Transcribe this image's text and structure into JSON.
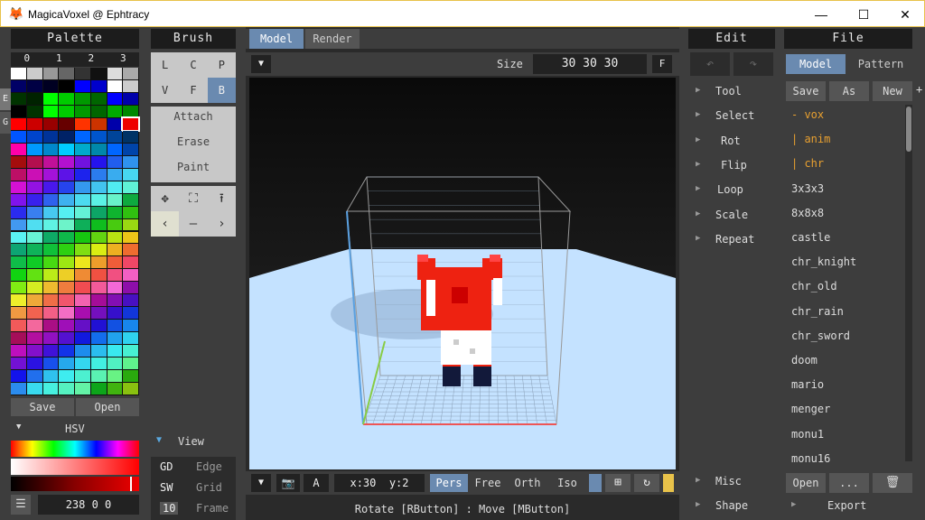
{
  "window": {
    "title": "MagicaVoxel @ Ephtracy",
    "min": "—",
    "max": "☐",
    "close": "✕"
  },
  "palette": {
    "title": "Palette",
    "pages": [
      "0",
      "1",
      "2",
      "3"
    ],
    "side_tabs": [
      "E",
      "G"
    ],
    "save": "Save",
    "open": "Open",
    "hsv_label": "HSV",
    "value": "238 0 0",
    "menu_icon": "menu-icon",
    "colors": [
      "#ffffff",
      "#cccccc",
      "#999999",
      "#666666",
      "#333333",
      "#111111",
      "#dddddd",
      "#aaaaaa",
      "#000066",
      "#000044",
      "#000022",
      "#000000",
      "#0000ff",
      "#0000cc",
      "#ffffff",
      "#cccccc",
      "#003300",
      "#002200",
      "#00ff00",
      "#00cc00",
      "#009900",
      "#006600",
      "#0000ff",
      "#0000aa",
      "#000000",
      "#003300",
      "#00ff00",
      "#00cc00",
      "#009900",
      "#006600",
      "#00aa00",
      "#008800",
      "#ff0000",
      "#cc0000",
      "#990000",
      "#660000",
      "#ff3300",
      "#cc3300",
      "#0000aa",
      "#ee0000",
      "#0055ff",
      "#0044cc",
      "#003399",
      "#002266",
      "#0066ff",
      "#0055cc",
      "#004499",
      "#003366",
      "#ff00aa",
      "#0099ff",
      "#0088cc",
      "#00ccff",
      "#00aacc",
      "#0088aa",
      "#0066ff",
      "#0044aa"
    ]
  },
  "brush": {
    "title": "Brush",
    "modes": [
      "L",
      "C",
      "P",
      "V",
      "F",
      "B"
    ],
    "actions": [
      "Attach",
      "Erase",
      "Paint"
    ],
    "view_label": "View",
    "view_opts": [
      {
        "key": "GD",
        "name": "Edge"
      },
      {
        "key": "SW",
        "name": "Grid"
      },
      {
        "key": "10",
        "name": "Frame"
      }
    ]
  },
  "tabs": {
    "model": "Model",
    "render": "Render"
  },
  "toolbar": {
    "size_label": "Size",
    "size_value": "30 30 30",
    "f_btn": "F"
  },
  "bottombar": {
    "a_btn": "A",
    "coords": "x:30  y:2",
    "modes": [
      "Pers",
      "Free",
      "Orth",
      "Iso"
    ]
  },
  "status": "Rotate [RButton] : Move [MButton]",
  "edit": {
    "title": "Edit",
    "items": [
      "Tool",
      "Select",
      "Rot",
      "Flip",
      "Loop",
      "Scale",
      "Repeat"
    ],
    "misc": "Misc",
    "shape": "Shape"
  },
  "file": {
    "title": "File",
    "tabs": [
      "Model",
      "Pattern"
    ],
    "actions": [
      "Save",
      "As",
      "New"
    ],
    "plus": "+",
    "tree": [
      "- vox",
      "| anim",
      "| chr"
    ],
    "items": [
      "3x3x3",
      "8x8x8",
      "castle",
      "chr_knight",
      "chr_old",
      "chr_rain",
      "chr_sword",
      "doom",
      "mario",
      "menger",
      "monu1",
      "monu16"
    ],
    "open": "Open",
    "more": "...",
    "export": "Export"
  }
}
